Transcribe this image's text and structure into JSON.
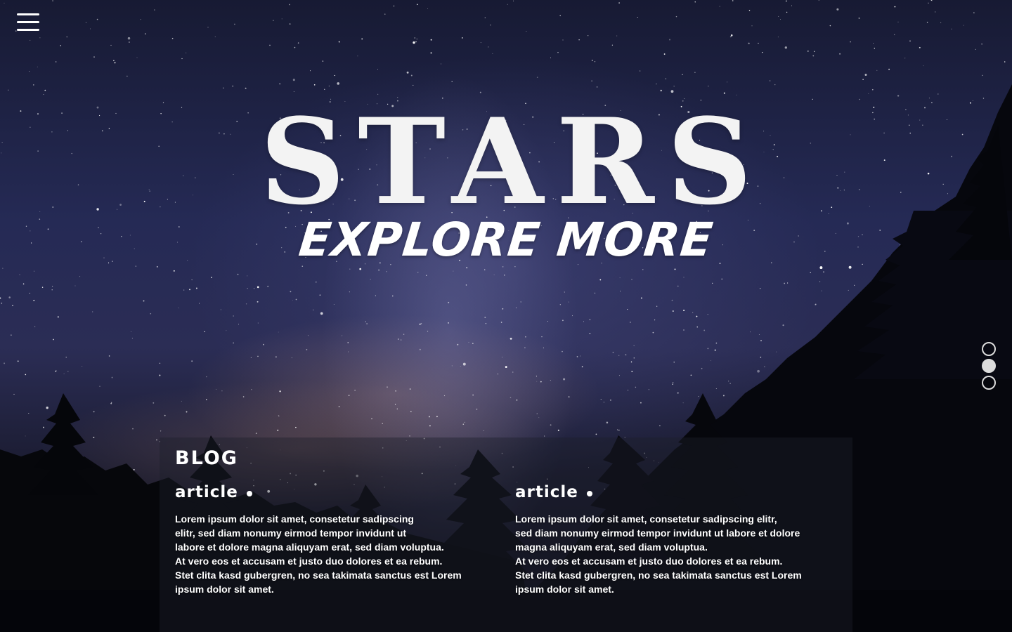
{
  "nav": {
    "menu_icon": "hamburger-menu-icon"
  },
  "hero": {
    "title": "STARS",
    "tagline": "EXPLORE MORE"
  },
  "pagination": {
    "dots": [
      {
        "active": false
      },
      {
        "active": true
      },
      {
        "active": false
      }
    ]
  },
  "blog": {
    "heading": "BLOG",
    "articles": [
      {
        "title": "article",
        "body": "Lorem ipsum dolor sit amet, consetetur sadipscing\nelitr, sed diam nonumy eirmod tempor invidunt ut\nlabore et dolore magna aliquyam erat, sed diam voluptua.\nAt vero eos et accusam et justo duo dolores et ea rebum.\nStet clita kasd gubergren, no sea takimata sanctus est Lorem\nipsum dolor sit amet."
      },
      {
        "title": "article",
        "body": "Lorem ipsum dolor sit amet, consetetur sadipscing elitr,\nsed diam nonumy eirmod tempor invidunt ut labore et dolore\nmagna aliquyam erat, sed diam voluptua.\nAt vero eos et accusam et justo duo dolores et ea rebum.\nStet clita kasd gubergren, no sea takimata sanctus est Lorem\nipsum dolor sit amet."
      }
    ]
  },
  "colors": {
    "text": "#ffffff",
    "sky_dark": "#171a33",
    "sky_mid": "#2b2d55",
    "tree_silhouette": "#05060a",
    "panel_overlay": "#1c1e2c",
    "dot": "#dcdcdc"
  }
}
